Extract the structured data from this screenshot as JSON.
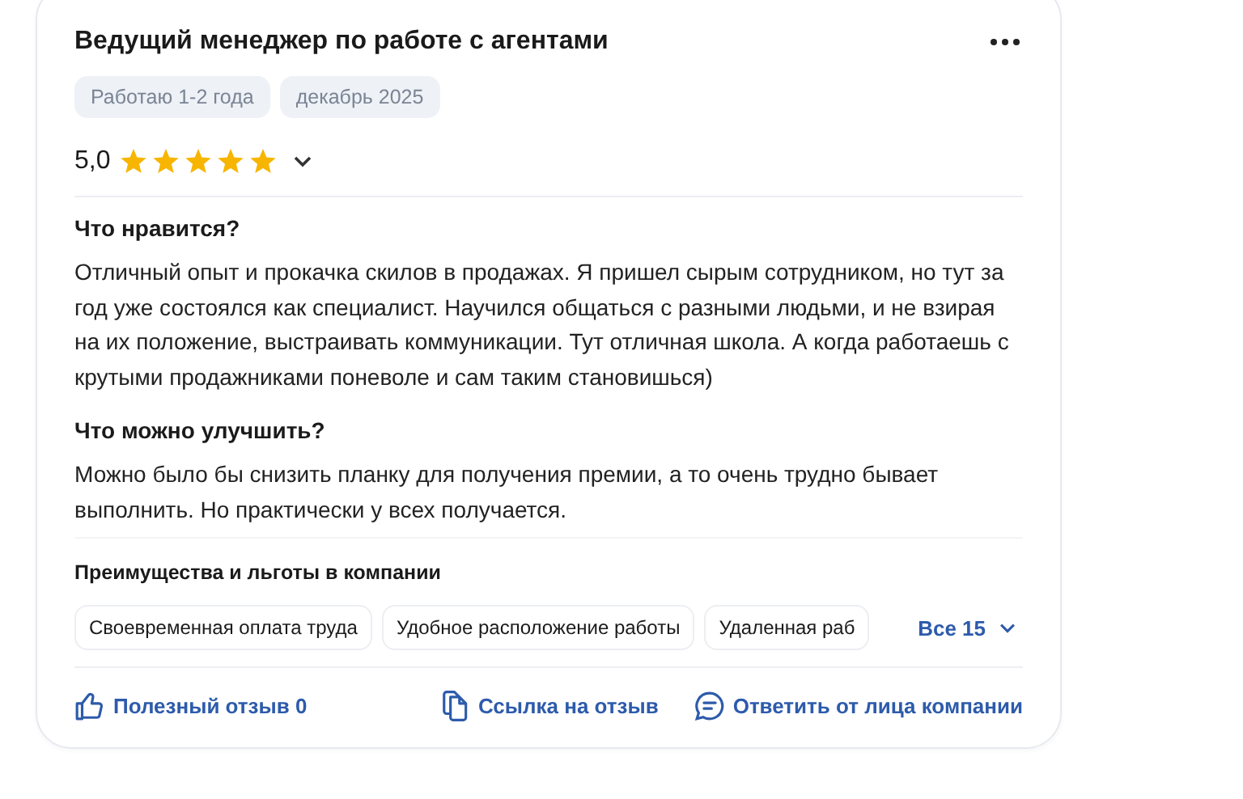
{
  "review": {
    "title": "Ведущий менеджер по работе с агентами",
    "tags": [
      "Работаю 1-2 года",
      "декабрь 2025"
    ],
    "rating": {
      "value": "5,0",
      "stars": 5
    },
    "sections": [
      {
        "heading": "Что нравится?",
        "text": "Отличный опыт и прокачка скилов в продажах. Я пришел сырым сотрудником, но тут за год уже состоялся как специалист. Научился общаться с разными людьми, и не взирая на их положение, выстраивать коммуникации. Тут отличная школа. А когда работаешь с крутыми продажниками поневоле и сам таким становишься)"
      },
      {
        "heading": "Что можно улучшить?",
        "text": "Можно было бы снизить планку для получения премии, а то очень трудно бывает выполнить. Но практически у всех получается."
      }
    ],
    "perks": {
      "heading": "Преимущества и льготы в компании",
      "items": [
        "Своевременная оплата труда",
        "Удобное расположение работы",
        "Удаленная раб"
      ],
      "more": "Все 15"
    },
    "actions": [
      {
        "kind": "like",
        "label": "Полезный отзыв 0"
      },
      {
        "kind": "link",
        "label": "Ссылка на отзыв"
      },
      {
        "kind": "reply",
        "label": "Ответить от лица компании"
      }
    ]
  }
}
